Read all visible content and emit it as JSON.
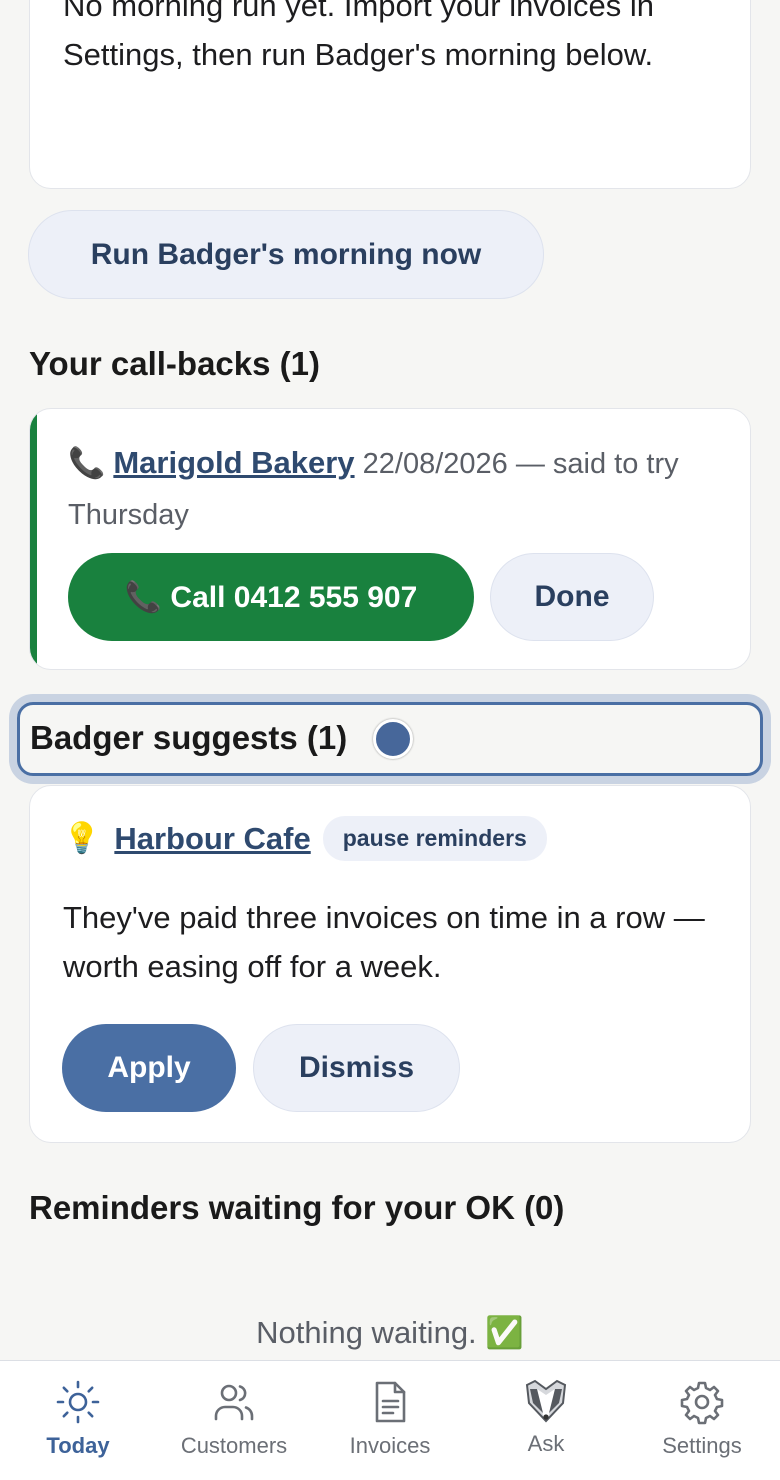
{
  "intro": {
    "text": "No morning run yet. Import your invoices in Settings, then run Badger's morning below."
  },
  "run_button": "Run Badger's morning now",
  "callbacks": {
    "title": "Your call-backs (1)",
    "items": [
      {
        "icon": "phone-icon",
        "customer": "Marigold Bakery",
        "details": "22/08/2026 — said to try Thursday",
        "call_label": "📞 Call 0412 555 907",
        "done_label": "Done"
      }
    ]
  },
  "suggestions": {
    "title": "Badger suggests (1)",
    "items": [
      {
        "icon": "lightbulb-icon",
        "customer": "Harbour Cafe",
        "tag": "pause reminders",
        "text": "They've paid three invoices on time in a row — worth easing off for a week.",
        "apply_label": "Apply",
        "dismiss_label": "Dismiss"
      }
    ]
  },
  "reminders": {
    "title": "Reminders waiting for your OK (0)",
    "empty": "Nothing waiting. ✅"
  },
  "nav": {
    "items": [
      {
        "label": "Today",
        "icon": "sun-icon",
        "active": true
      },
      {
        "label": "Customers",
        "icon": "users-icon",
        "active": false
      },
      {
        "label": "Invoices",
        "icon": "document-icon",
        "active": false
      },
      {
        "label": "Ask",
        "icon": "badger-icon",
        "active": false
      },
      {
        "label": "Settings",
        "icon": "gear-icon",
        "active": false
      }
    ]
  },
  "colors": {
    "accent": "#4a6fa4",
    "call_green": "#19813e",
    "soft_button": "#edf0f8",
    "background": "#f6f6f4"
  }
}
